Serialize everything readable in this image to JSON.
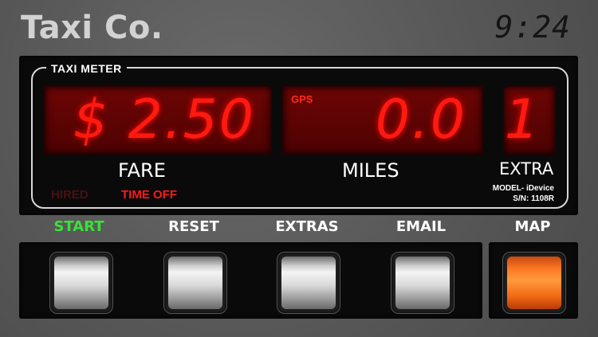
{
  "header": {
    "brand": "Taxi Co.",
    "clock": "9:24"
  },
  "meter": {
    "title": "TAXI METER",
    "fare_display": "$ 2.50",
    "miles_display": "0.0",
    "extra_display": "1",
    "gps_label": "GPS",
    "fare_label": "FARE",
    "miles_label": "MILES",
    "extra_label": "EXTRA",
    "status_hired": "HIRED",
    "status_time_off": "TIME OFF",
    "model_line": "MODEL- iDevice",
    "serial_line": "S/N: 1108R"
  },
  "buttons": {
    "start": "START",
    "reset": "RESET",
    "extras": "EXTRAS",
    "email": "EMAIL",
    "map": "MAP"
  },
  "colors": {
    "display_red": "#ff1a10",
    "start_green": "#39e238",
    "map_orange": "#ff7a25"
  }
}
